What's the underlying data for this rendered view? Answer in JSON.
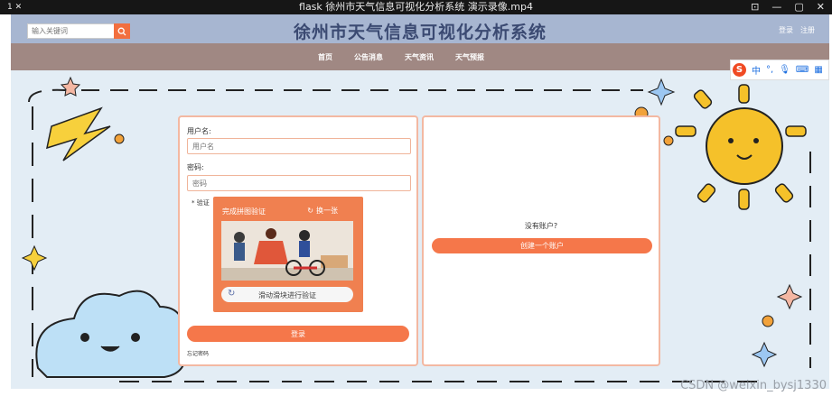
{
  "video_window": {
    "title": "flask 徐州市天气信息可视化分析系统 演示录像.mp4",
    "left_text": "1 ✕"
  },
  "header": {
    "search_placeholder": "输入关键词",
    "site_title": "徐州市天气信息可视化分析系统",
    "login_link": "登录",
    "register_link": "注册"
  },
  "nav": {
    "items": [
      "首页",
      "公告消息",
      "天气资讯",
      "天气预报"
    ]
  },
  "ime": {
    "logo": "S",
    "lang": "中"
  },
  "login_form": {
    "username_label": "用户名:",
    "username_placeholder": "用户名",
    "password_label": "密码:",
    "password_placeholder": "密码",
    "captcha_label": "* 验证",
    "captcha_title": "完成拼图验证",
    "captcha_refresh": "换一张",
    "captcha_slider_text": "滑动滑块进行验证",
    "login_button": "登录",
    "forgot_password": "忘记密码"
  },
  "register_panel": {
    "prompt": "没有账户?",
    "create_button": "创建一个账户"
  },
  "watermark": "CSDN @weixin_bysj1330",
  "colors": {
    "accent": "#f5774a",
    "header_bg": "#a7b6d1",
    "nav_bg": "#a08883"
  }
}
